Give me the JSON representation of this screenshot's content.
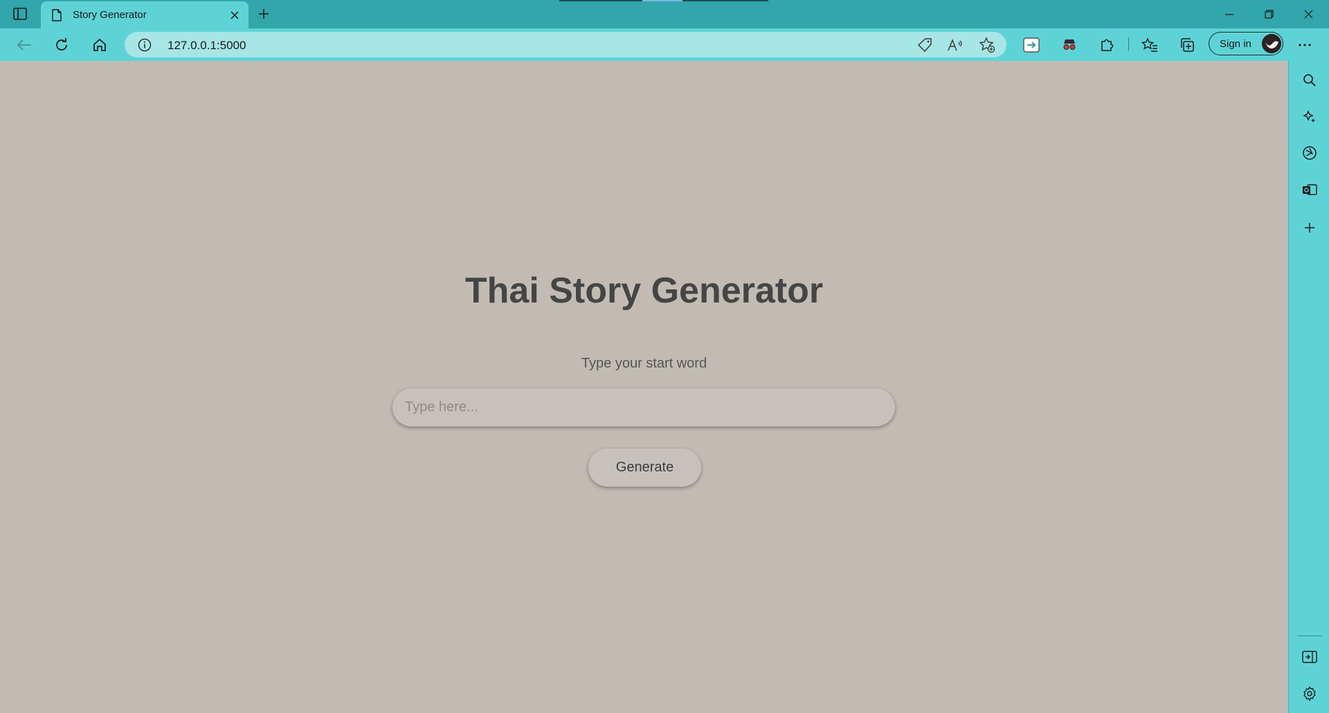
{
  "browser": {
    "tab": {
      "title": "Story Generator",
      "favicon": "page-icon"
    },
    "address": {
      "url": "127.0.0.1:5000"
    },
    "signin_label": "Sign in",
    "colors": {
      "frame": "#31a6ab",
      "toolbar": "#5ed3d6",
      "address_bg": "#a7e5e6",
      "page_bg": "#c2bbb4"
    }
  },
  "page": {
    "title": "Thai Story Generator",
    "prompt": "Type your start word",
    "input": {
      "placeholder": "Type here...",
      "value": ""
    },
    "button_label": "Generate"
  }
}
